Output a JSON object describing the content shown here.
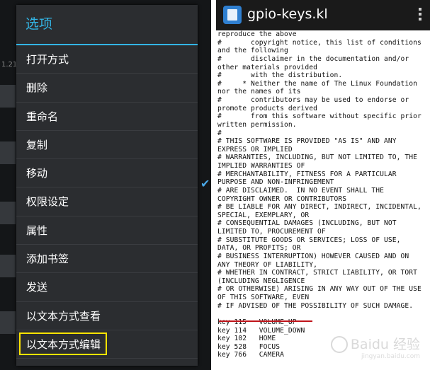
{
  "left": {
    "menu": {
      "title": "选项",
      "items": [
        {
          "label": "打开方式"
        },
        {
          "label": "删除"
        },
        {
          "label": "重命名"
        },
        {
          "label": "复制"
        },
        {
          "label": "移动"
        },
        {
          "label": "权限设定"
        },
        {
          "label": "属性"
        },
        {
          "label": "添加书签"
        },
        {
          "label": "发送"
        },
        {
          "label": "以文本方式查看"
        },
        {
          "label": "以文本方式编辑",
          "highlighted": true
        }
      ],
      "accent_color": "#33b5e5",
      "highlight_color": "#ffe400"
    },
    "background_fragment": "1.21"
  },
  "right": {
    "title": "gpio-keys.kl",
    "lines": [
      "reproduce the above",
      "#       copyright notice, this list of conditions",
      "and the following",
      "#       disclaimer in the documentation and/or",
      "other materials provided",
      "#       with the distribution.",
      "#     * Neither the name of The Linux Foundation",
      "nor the names of its",
      "#       contributors may be used to endorse or",
      "promote products derived",
      "#       from this software without specific prior",
      "written permission.",
      "#",
      "# THIS SOFTWARE IS PROVIDED \"AS IS\" AND ANY",
      "EXPRESS OR IMPLIED",
      "# WARRANTIES, INCLUDING, BUT NOT LIMITED TO, THE",
      "IMPLIED WARRANTIES OF",
      "# MERCHANTABILITY, FITNESS FOR A PARTICULAR",
      "PURPOSE AND NON-INFRINGEMENT",
      "# ARE DISCLAIMED.  IN NO EVENT SHALL THE",
      "COPYRIGHT OWNER OR CONTRIBUTORS",
      "# BE LIABLE FOR ANY DIRECT, INDIRECT, INCIDENTAL,",
      "SPECIAL, EXEMPLARY, OR",
      "# CONSEQUENTIAL DAMAGES (INCLUDING, BUT NOT",
      "LIMITED TO, PROCUREMENT OF",
      "# SUBSTITUTE GOODS OR SERVICES; LOSS OF USE,",
      "DATA, OR PROFITS; OR",
      "# BUSINESS INTERRUPTION) HOWEVER CAUSED AND ON",
      "ANY THEORY OF LIABILITY,",
      "# WHETHER IN CONTRACT, STRICT LIABILITY, OR TORT",
      "(INCLUDING NEGLIGENCE",
      "# OR OTHERWISE) ARISING IN ANY WAY OUT OF THE USE",
      "OF THIS SOFTWARE, EVEN",
      "# IF ADVISED OF THE POSSIBILITY OF SUCH DAMAGE.",
      "",
      "key 115   VOLUME_UP",
      "key 114   VOLUME_DOWN",
      "key 102   HOME",
      "key 528   FOCUS",
      "key 766   CAMERA"
    ],
    "underline_color": "#c0141a",
    "watermark": "Baidu 经验",
    "watermark_sub": "jingyan.baidu.com"
  }
}
